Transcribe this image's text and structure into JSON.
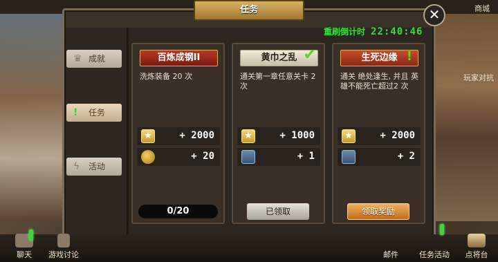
{
  "panel": {
    "title": "任务",
    "close_icon": "close-icon",
    "timer_label": "重刷倒计时",
    "timer_value": "22:40:46"
  },
  "top_bar": {
    "right_label": "商城"
  },
  "right_tag": "玩家对抗",
  "sidebar": {
    "items": [
      {
        "label": "成就",
        "icon": "crown-icon",
        "active": false
      },
      {
        "label": "任务",
        "icon": "exclamation-icon",
        "active": true
      },
      {
        "label": "活动",
        "icon": "lightning-icon",
        "active": false
      }
    ]
  },
  "quests": [
    {
      "title": "百炼成钢II",
      "description": "洗炼装备 20 次",
      "rewards": [
        {
          "icon": "star-icon",
          "value": "+ 2000"
        },
        {
          "icon": "gold-coin-icon",
          "value": "+ 20"
        }
      ],
      "progress": "0/20"
    },
    {
      "title": "黄巾之乱",
      "description": "通关第一章任意关卡 2 次",
      "rewards": [
        {
          "icon": "star-icon",
          "value": "+ 1000"
        },
        {
          "icon": "badge-icon",
          "value": "+ 1"
        }
      ],
      "button": "已领取"
    },
    {
      "title": "生死边缘",
      "description": "通关 绝处逢生, 并且 英雄不能死亡超过2 次",
      "rewards": [
        {
          "icon": "star-icon",
          "value": "+ 2000"
        },
        {
          "icon": "badge-icon",
          "value": "+ 2"
        }
      ],
      "button": "领取奖励"
    }
  ],
  "bottom_bar": {
    "items": [
      "聊天",
      "游戏讨论",
      "邮件",
      "任务活动",
      "点将台"
    ]
  },
  "colors": {
    "accent_green": "#36e03a",
    "title_red": "#b83a2a",
    "button_orange": "#c06a18"
  }
}
